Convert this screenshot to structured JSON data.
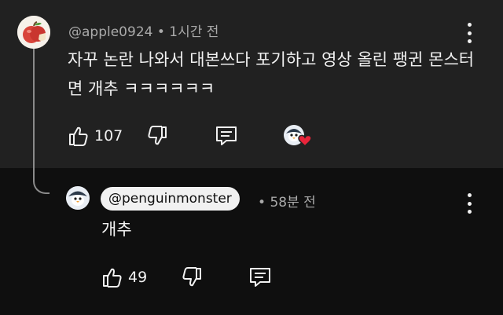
{
  "main_comment": {
    "handle": "@apple0924",
    "separator": "•",
    "time": "1시간 전",
    "text": "자꾸 논란 나와서 대본쓰다 포기하고 영상 올린 팽귄 몬스터면 개추 ㅋㅋㅋㅋㅋㅋ",
    "like_count": "107",
    "avatar": "apple-avatar",
    "creator_heart": "penguin-heart-badge"
  },
  "reply": {
    "handle": "@penguinmonster",
    "separator": "•",
    "time": "58분 전",
    "text": "개추",
    "like_count": "49",
    "avatar": "penguin-avatar"
  },
  "colors": {
    "comment_bg": "#212121",
    "reply_bg": "#0f0f0f",
    "text": "#f1f1f1",
    "meta": "#aaaaaa",
    "heart": "#e8243a"
  }
}
